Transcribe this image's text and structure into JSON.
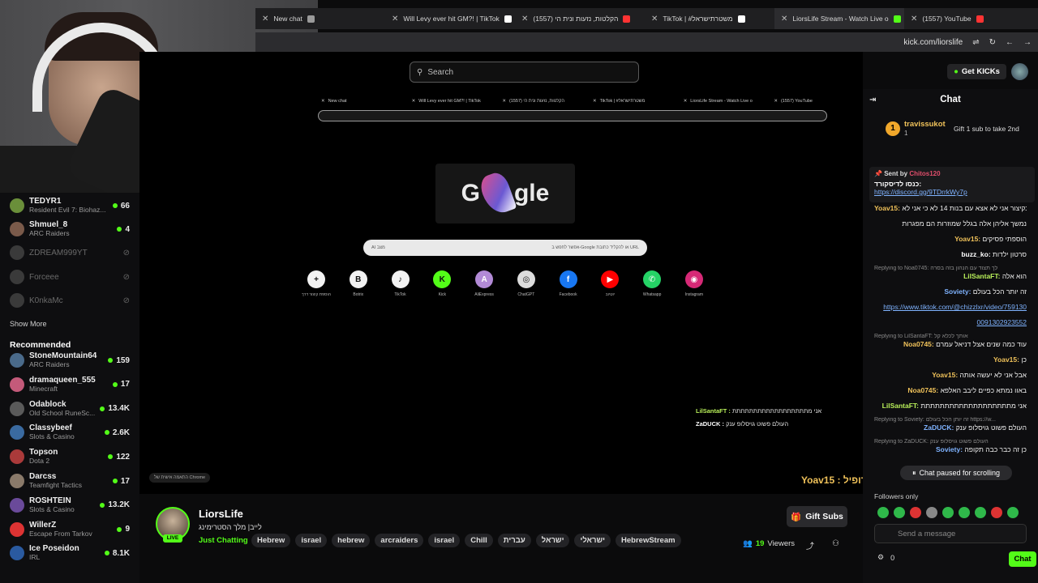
{
  "browser": {
    "tabs": [
      {
        "label": "New chat",
        "color": "#9a9a9a"
      },
      {
        "label": "Will Levy ever hit GM?! | TikTok",
        "color": "#ffffff"
      },
      {
        "label": "(1557) הקלטות, נזעות ונית הי",
        "color": "#ff3333"
      },
      {
        "label": "TikTok | #משטרתישראל",
        "color": "#ffffff"
      },
      {
        "label": "LiorsLife Stream - Watch Live o",
        "color": "#53fc18"
      },
      {
        "label": "(1557) YouTube",
        "color": "#ff3333"
      }
    ],
    "url": "kick.com/liorslife"
  },
  "sidebar": {
    "following": [
      {
        "name": "TEDYR1",
        "game": "Resident Evil 7: Biohaz...",
        "viewers": "66",
        "color": "#6a8f3a"
      },
      {
        "name": "Shmuel_8",
        "game": "ARC Raiders",
        "viewers": "4",
        "color": "#7a5a4a"
      },
      {
        "name": "ZDREAM999YT",
        "game": "",
        "viewers": "",
        "color": "#3a3a3a"
      },
      {
        "name": "Forceee",
        "game": "",
        "viewers": "",
        "color": "#3a3a3a"
      },
      {
        "name": "K0nkaMc",
        "game": "",
        "viewers": "",
        "color": "#3a3a3a"
      }
    ],
    "show_more": "Show More",
    "recommended_title": "Recommended",
    "recommended": [
      {
        "name": "StoneMountain64",
        "game": "ARC Raiders",
        "viewers": "159",
        "color": "#4a6a8a"
      },
      {
        "name": "dramaqueen_555",
        "game": "Minecraft",
        "viewers": "17",
        "color": "#c45a7a"
      },
      {
        "name": "Odablock",
        "game": "Old School RuneSc...",
        "viewers": "13.4K",
        "color": "#5a5a5a"
      },
      {
        "name": "Classybeef",
        "game": "Slots & Casino",
        "viewers": "2.6K",
        "color": "#3a6aa0"
      },
      {
        "name": "Topson",
        "game": "Dota 2",
        "viewers": "122",
        "color": "#aa3a3a"
      },
      {
        "name": "Darcss",
        "game": "Teamfight Tactics",
        "viewers": "17",
        "color": "#8a7a6a"
      },
      {
        "name": "ROSHTEIN",
        "game": "Slots & Casino",
        "viewers": "13.2K",
        "color": "#6a4a9a"
      },
      {
        "name": "WillerZ",
        "game": "Escape From Tarkov",
        "viewers": "9",
        "color": "#d33"
      },
      {
        "name": "Ice Poseidon",
        "game": "IRL",
        "viewers": "8.1K",
        "color": "#2a5aa0"
      }
    ]
  },
  "stream": {
    "search_placeholder": "Search",
    "inner_tabs": [
      "New chat",
      "Will Levy ever hit GM?! | TikTok",
      "הקלטות, נזעות ונית הי (1557)",
      "TikTok | #משטרתישראל",
      "LiorsLife Stream - Watch Live o",
      "(1557) YouTube"
    ],
    "inner_search": "אפשר לחפש ב-Google או להקליד כתובת URL",
    "inner_search_ai": "AI מצב",
    "shortcuts": [
      {
        "label": "הוספת קיצור דרך",
        "glyph": "+",
        "color": "#f2f2f2"
      },
      {
        "label": "Botrix",
        "glyph": "B",
        "color": "#f2f2f2"
      },
      {
        "label": "TikTok",
        "glyph": "♪",
        "color": "#f2f2f2"
      },
      {
        "label": "Kick",
        "glyph": "K",
        "color": "#53fc18"
      },
      {
        "label": "AliExpress",
        "glyph": "A",
        "color": "#b28ad6"
      },
      {
        "label": "ChatGPT",
        "glyph": "◎",
        "color": "#dcdcdc"
      },
      {
        "label": "Facebook",
        "glyph": "f",
        "color": "#1877f2"
      },
      {
        "label": "יוטיוב",
        "glyph": "▶",
        "color": "#ff0000"
      },
      {
        "label": "Whatsapp",
        "glyph": "✆",
        "color": "#25d366"
      },
      {
        "label": "Instagram",
        "glyph": "◉",
        "color": "#d62976"
      }
    ],
    "overlay_msgs": [
      {
        "user": "LilSantaFT",
        "text": "אני מתתתתתתתתתתתתתתתתתת"
      },
      {
        "user": "ZaDUCK",
        "text": "העולם פשוט גויסלופ ענק"
      }
    ],
    "chrome_note": "התאמה אישית של Chrome",
    "overlay_user": "Yoav15 : מי פדופיל"
  },
  "channel": {
    "name": "LiorsLife",
    "title": "לייב| מלך הסטרימינג",
    "live": "LIVE",
    "category": "Just Chatting",
    "tags": [
      "Hebrew",
      "israel",
      "hebrew",
      "arcraiders",
      "israel",
      "Chill",
      "עברית",
      "ישראל",
      "ישראלי",
      "HebrewStream"
    ],
    "gift_subs": "Gift Subs",
    "viewers": "19",
    "viewers_label": "Viewers"
  },
  "chat": {
    "get_kicks": "Get KICKs",
    "title": "Chat",
    "pinned_user": "travissukot",
    "pinned_count": "1",
    "gift_cta": "Gift 1 sub to take 2nd",
    "pin_sent_by": "Sent by",
    "pin_sender": "Chitos120",
    "pin_message": "כנסו לדיסקורד:",
    "pin_link": "https://discord.gg/9TDrrkWy7p",
    "messages": [
      {
        "reply": "",
        "user": "Yoav15",
        "color": "#f0c25a",
        "text": "ובקיצור אני לא אצא עם בנות 14 לא כי אני לא"
      },
      {
        "reply": "",
        "user": "",
        "color": "#ffffff",
        "text": "נמשך אליהן אלה בגלל שמוזרות הם מפגרות"
      },
      {
        "reply": "",
        "user": "Yoav15",
        "color": "#f0c25a",
        "text": "הוספתי פסיקים"
      },
      {
        "reply": "",
        "user": "buzz_ko",
        "color": "#ffffff",
        "text": "סרטון ילדות"
      },
      {
        "reply": "Replying to Noa0745: לך תצוד עם הנהון בזה בסרה",
        "user": "LilSantaFT",
        "color": "#b9f05a",
        "text": "הוא אלה"
      },
      {
        "reply": "",
        "user": "Soviety",
        "color": "#7fb3ff",
        "text": "זה יותר הכל בעולם"
      },
      {
        "reply": "",
        "user": "",
        "color": "#7fb3ff",
        "text": "https://www.tiktok.com/@chizzlxr/video/759130"
      },
      {
        "reply": "",
        "user": "",
        "color": "#7fb3ff",
        "text": "0091302923552"
      },
      {
        "reply": "Replying to LilSantaFT: אותך לכלא קל",
        "user": "Noa0745",
        "color": "#f0c25a",
        "text": "עוד כמה שנים אצל דניאל עמרם"
      },
      {
        "reply": "",
        "user": "Yoav15",
        "color": "#f0c25a",
        "text": "כן"
      },
      {
        "reply": "",
        "user": "Yoav15",
        "color": "#f0c25a",
        "text": "אבל אני לא יעשה אותה"
      },
      {
        "reply": "",
        "user": "Noa0745",
        "color": "#f0c25a",
        "text": "באוו נמתא כפיים ליבב האלפא"
      },
      {
        "reply": "",
        "user": "LilSantaFT",
        "color": "#b9f05a",
        "text": "אני מתתתתתתתתתתתתתתתתתתת"
      },
      {
        "reply": "Replying to Soviety: זה יותן הכל בעולם https://w...",
        "user": "ZaDUCK",
        "color": "#7fb3ff",
        "text": "העולם פשוט גויסלופ ענק"
      },
      {
        "reply": "Replying to ZaDUCK: העולם פשוט גויסלופ ענק",
        "user": "Soviety",
        "color": "#7fb3ff",
        "text": "כן זה כבר כבה תקופה"
      }
    ],
    "paused": "Chat paused for scrolling",
    "followers_only": "Followers only",
    "send_placeholder": "Send a message",
    "bottom_count": "0",
    "chat_button": "Chat"
  },
  "colors": {
    "accent": "#53fc18",
    "bg": "#0b0b0c",
    "panel": "#0e0e10"
  }
}
